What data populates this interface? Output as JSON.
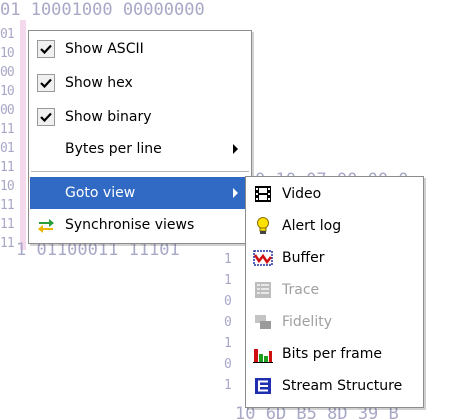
{
  "background": {
    "top_row": "01 10001000 00000000",
    "mid_row": "0 10 07 00 00 0",
    "bottom_left_row": "1 01100011 11101",
    "bottom_right_row": "10 6D B5 8D 39 B",
    "left_column": [
      "01",
      "10",
      "00",
      "10",
      "00",
      "11",
      "01",
      "11",
      "10",
      "11",
      "11",
      "11"
    ],
    "mid_column": [
      "0",
      "1",
      "1",
      "1",
      "1",
      "0",
      "0",
      "1",
      "0",
      "1"
    ]
  },
  "context_menu": {
    "items": [
      {
        "label": "Show ASCII",
        "checked": true
      },
      {
        "label": "Show hex",
        "checked": true
      },
      {
        "label": "Show binary",
        "checked": true
      },
      {
        "label": "Bytes per line",
        "submenu": true
      },
      {
        "label": "Goto view",
        "submenu": true,
        "highlighted": true
      },
      {
        "label": "Synchronise views",
        "icon": "sync-arrows-icon"
      }
    ]
  },
  "goto_submenu": {
    "items": [
      {
        "label": "Video",
        "icon": "film-icon",
        "enabled": true
      },
      {
        "label": "Alert log",
        "icon": "lightbulb-icon",
        "enabled": true
      },
      {
        "label": "Buffer",
        "icon": "buffer-graph-icon",
        "enabled": true
      },
      {
        "label": "Trace",
        "icon": "trace-grid-icon",
        "enabled": false
      },
      {
        "label": "Fidelity",
        "icon": "fidelity-windows-icon",
        "enabled": false
      },
      {
        "label": "Bits per frame",
        "icon": "bar-chart-icon",
        "enabled": true
      },
      {
        "label": "Stream Structure",
        "icon": "stream-structure-icon",
        "enabled": true
      }
    ]
  },
  "colors": {
    "highlight": "#316ac5",
    "disabled_text": "#a0a0a0",
    "background_text": "#a8a8c8"
  }
}
